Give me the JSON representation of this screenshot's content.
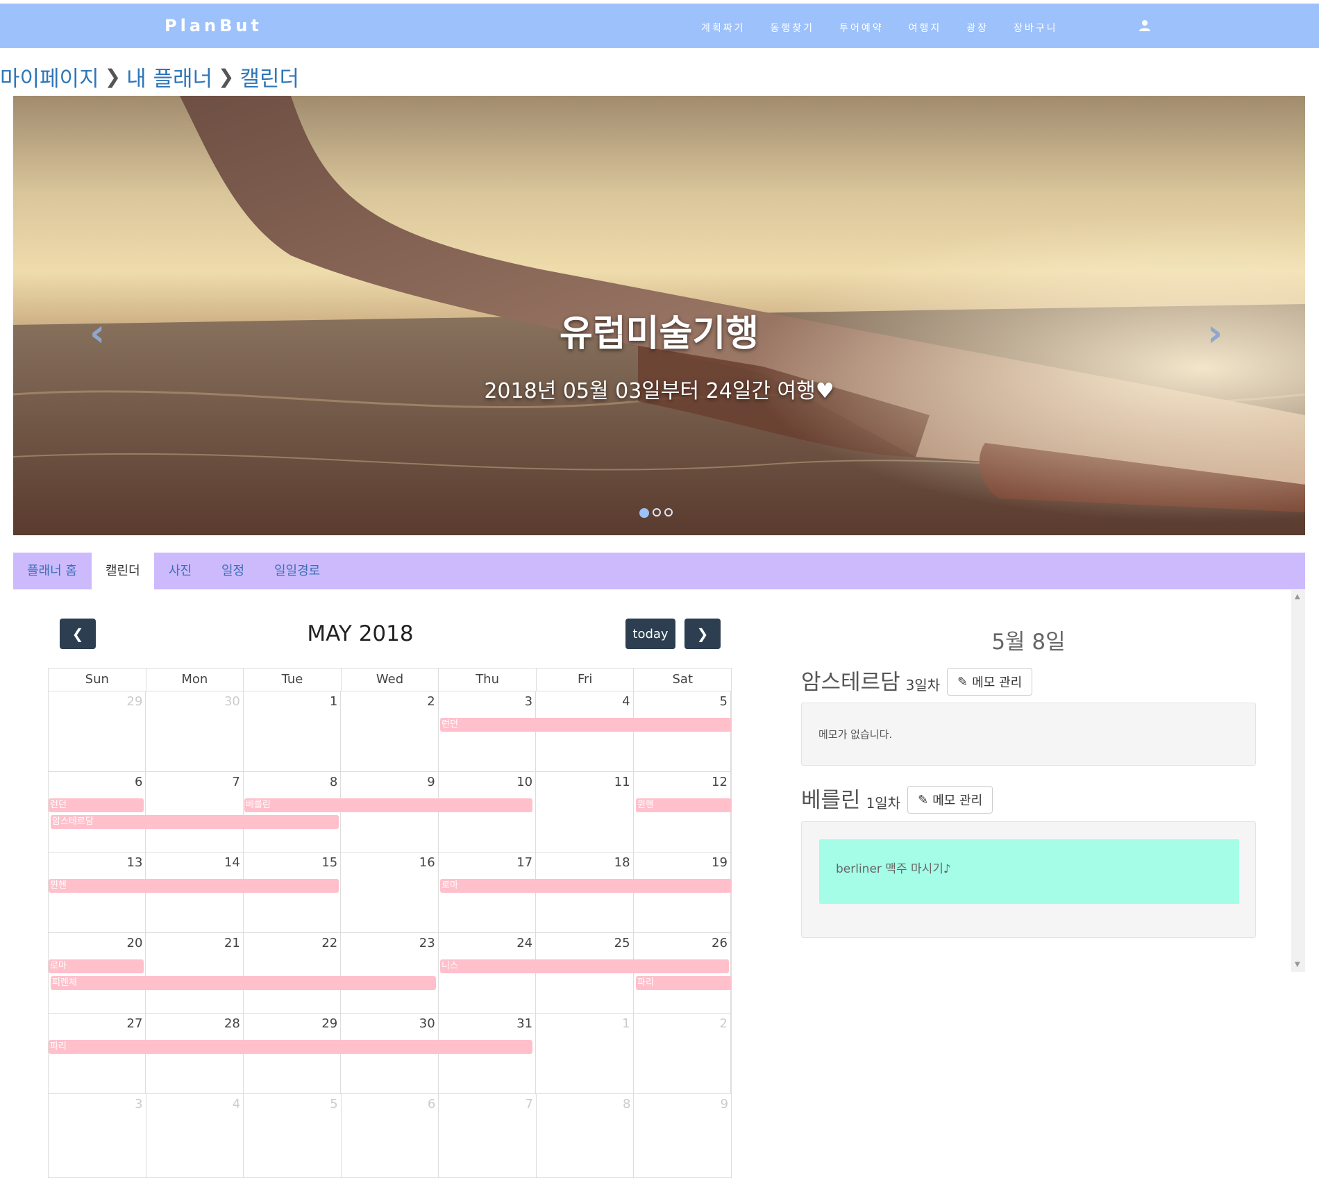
{
  "nav": {
    "brand": "PlanBut",
    "items": [
      "계획짜기",
      "동행찾기",
      "투어예약",
      "여행지",
      "광장",
      "장바구니"
    ],
    "user_icon": "user-icon"
  },
  "breadcrumb": [
    "마이페이지",
    "내 플래너",
    "캘린더"
  ],
  "hero": {
    "title": "유럽미술기행",
    "subtitle": "2018년 05월 03일부터 24일간 여행♥",
    "prev": "‹",
    "next": "›"
  },
  "tabs": [
    "플래너 홈",
    "캘린더",
    "사진",
    "일정",
    "일일경로"
  ],
  "calendar": {
    "title": "MAY 2018",
    "today_label": "today",
    "days_of_week": [
      "Sun",
      "Mon",
      "Tue",
      "Wed",
      "Thu",
      "Fri",
      "Sat"
    ],
    "weeks": [
      [
        "29",
        "30",
        "1",
        "2",
        "3",
        "4",
        "5"
      ],
      [
        "6",
        "7",
        "8",
        "9",
        "10",
        "11",
        "12"
      ],
      [
        "13",
        "14",
        "15",
        "16",
        "17",
        "18",
        "19"
      ],
      [
        "20",
        "21",
        "22",
        "23",
        "24",
        "25",
        "26"
      ],
      [
        "27",
        "28",
        "29",
        "30",
        "31",
        "1",
        "2"
      ],
      [
        "3",
        "4",
        "5",
        "6",
        "7",
        "8",
        "9"
      ]
    ],
    "events": {
      "w1_london": "런던",
      "w2_london": "런던",
      "w2_amsterdam": "암스테르담",
      "w2_berlin": "베를린",
      "w2_munich": "뮌헨",
      "w3_munich": "뮌헨",
      "w3_rome": "로마",
      "w4_rome": "로마",
      "w4_florence": "피렌체",
      "w4_nice": "니스",
      "w4_paris": "파리",
      "w5_paris": "파리"
    },
    "event_color": "#ffc0cb"
  },
  "panel": {
    "date": "5월 8일",
    "memo_button": "메모 관리",
    "cities": [
      {
        "name": "암스테르담",
        "day": "3일차",
        "memo": "메모가 없습니다."
      },
      {
        "name": "베를린",
        "day": "1일차",
        "memo": "berliner 맥주 마시기♪"
      }
    ]
  },
  "colors": {
    "navbar": "#9dc1fb",
    "tabbar": "#ccbafd",
    "calendar_button": "#2c3e50",
    "memo_note": "#a5fde7"
  }
}
